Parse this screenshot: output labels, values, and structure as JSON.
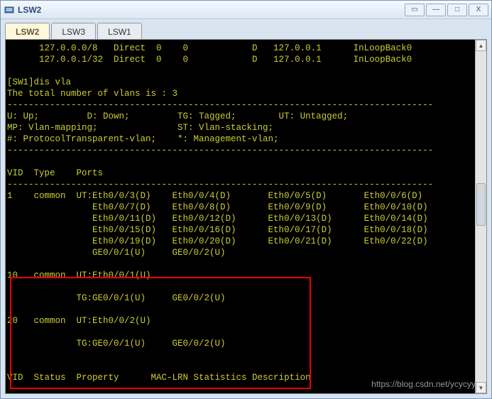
{
  "window": {
    "title": "LSW2"
  },
  "winbtns": {
    "collapse": "▭",
    "min": "—",
    "max": "□",
    "close": "X"
  },
  "tabs": [
    {
      "label": "LSW2",
      "active": true
    },
    {
      "label": "LSW3",
      "active": false
    },
    {
      "label": "LSW1",
      "active": false
    }
  ],
  "route_rows": [
    {
      "dest": "127.0.0.0/8",
      "proto": "Direct",
      "pre": "0",
      "cost": "0",
      "flags": "D",
      "nexthop": "127.0.0.1",
      "iface": "InLoopBack0"
    },
    {
      "dest": "127.0.0.1/32",
      "proto": "Direct",
      "pre": "0",
      "cost": "0",
      "flags": "D",
      "nexthop": "127.0.0.1",
      "iface": "InLoopBack0"
    }
  ],
  "cmd_line": "[SW1]dis vla",
  "vlan_count_line": "The total number of vlans is : 3",
  "legend": {
    "line1": "U: Up;         D: Down;         TG: Tagged;        UT: Untagged;",
    "line2": "MP: Vlan-mapping;               ST: Vlan-stacking;",
    "line3": "#: ProtocolTransparent-vlan;    *: Management-vlan;"
  },
  "vlan_header": "VID  Type    Ports",
  "vlan1": {
    "vid": "1",
    "type": "common",
    "rows": [
      [
        "UT:Eth0/0/3(D)",
        "Eth0/0/4(D)",
        "Eth0/0/5(D)",
        "Eth0/0/6(D)"
      ],
      [
        "   Eth0/0/7(D)",
        "Eth0/0/8(D)",
        "Eth0/0/9(D)",
        "Eth0/0/10(D)"
      ],
      [
        "   Eth0/0/11(D)",
        "Eth0/0/12(D)",
        "Eth0/0/13(D)",
        "Eth0/0/14(D)"
      ],
      [
        "   Eth0/0/15(D)",
        "Eth0/0/16(D)",
        "Eth0/0/17(D)",
        "Eth0/0/18(D)"
      ],
      [
        "   Eth0/0/19(D)",
        "Eth0/0/20(D)",
        "Eth0/0/21(D)",
        "Eth0/0/22(D)"
      ],
      [
        "   GE0/0/1(U)",
        "GE0/0/2(U)",
        "",
        ""
      ]
    ]
  },
  "vlan10": {
    "vid": "10",
    "type": "common",
    "ut": "UT:Eth0/0/1(U)",
    "tg": [
      "TG:GE0/0/1(U)",
      "GE0/0/2(U)"
    ]
  },
  "vlan20": {
    "vid": "20",
    "type": "common",
    "ut": "UT:Eth0/0/2(U)",
    "tg": [
      "TG:GE0/0/1(U)",
      "GE0/0/2(U)"
    ]
  },
  "footer_header": "VID  Status  Property      MAC-LRN Statistics Description",
  "dash": "--------------------------------------------------------------------------------",
  "watermark": "https://blog.csdn.net/ycycyy..."
}
